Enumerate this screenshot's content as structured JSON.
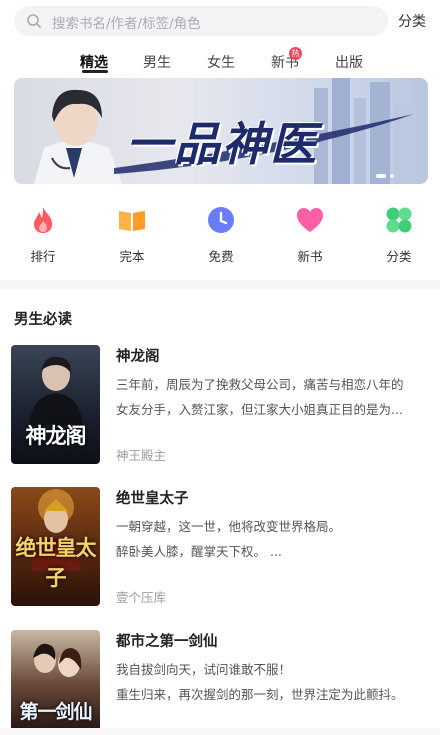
{
  "search": {
    "placeholder": "搜索书名/作者/标签/角色",
    "category_label": "分类"
  },
  "tabs": [
    {
      "label": "精选",
      "active": true
    },
    {
      "label": "男生"
    },
    {
      "label": "女生"
    },
    {
      "label": "新书",
      "badge": "热"
    },
    {
      "label": "出版"
    }
  ],
  "banner": {
    "title": "一品神医",
    "slides": 2,
    "active_slide": 1
  },
  "entries": [
    {
      "label": "排行",
      "icon": "flame-icon",
      "color": "#ff5a5f"
    },
    {
      "label": "完本",
      "icon": "book-icon",
      "color": "#ff9c2a"
    },
    {
      "label": "免费",
      "icon": "clock-icon",
      "color": "#6a7cff"
    },
    {
      "label": "新书",
      "icon": "heart-icon",
      "color": "#ff5fa5"
    },
    {
      "label": "分类",
      "icon": "grid-icon",
      "color": "#3fcf7a"
    }
  ],
  "section": {
    "title": "男生必读"
  },
  "books": [
    {
      "title": "神龙阁",
      "desc": [
        "三年前，周辰为了挽救父母公司，痛苦与相恋八年的",
        "女友分手，入赘江家，但江家大小姐真正目的是为..."
      ],
      "author": "神王殿主",
      "cover_text": "神龙阁"
    },
    {
      "title": "绝世皇太子",
      "desc": [
        "一朝穿越，这一世，他将改变世界格局。",
        "醉卧美人膝，醒掌天下权。 ..."
      ],
      "author": "壹个压库",
      "cover_text": "绝世皇太子"
    },
    {
      "title": "都市之第一剑仙",
      "desc": [
        "我自拔剑向天，试问谁敢不服！",
        "重生归来，再次握剑的那一刻，世界注定为此颤抖。"
      ],
      "author": "",
      "cover_text": "第一剑仙"
    }
  ],
  "colors": {
    "accent": "#222222",
    "muted": "#9a9da3",
    "badge": "#f0455c"
  }
}
